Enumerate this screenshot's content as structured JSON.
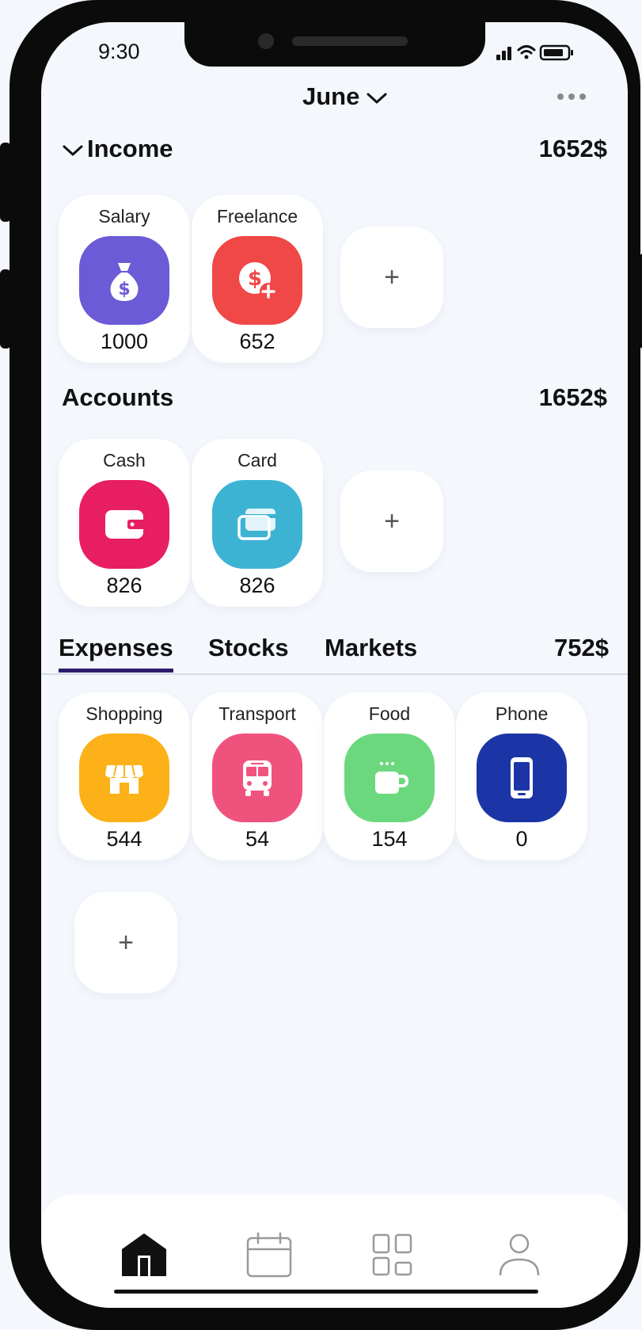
{
  "status_bar": {
    "time": "9:30",
    "icons": [
      "cellular-signal-icon",
      "wifi-icon",
      "battery-icon"
    ]
  },
  "header": {
    "month": "June",
    "menu_icon": "more-horizontal-icon"
  },
  "income": {
    "title": "Income",
    "total": "1652$",
    "items": [
      {
        "label": "Salary",
        "value": "1000",
        "icon": "money-bag-icon",
        "color": "#6B5BD6"
      },
      {
        "label": "Freelance",
        "value": "652",
        "icon": "dollar-plus-icon",
        "color": "#F04747"
      }
    ],
    "add_label": "+"
  },
  "accounts": {
    "title": "Accounts",
    "total": "1652$",
    "items": [
      {
        "label": "Cash",
        "value": "826",
        "icon": "wallet-icon",
        "color": "#E81E63"
      },
      {
        "label": "Card",
        "value": "826",
        "icon": "cards-icon",
        "color": "#3DB3D4"
      }
    ],
    "add_label": "+"
  },
  "tabs": {
    "items": [
      {
        "label": "Expenses",
        "active": true
      },
      {
        "label": "Stocks",
        "active": false
      },
      {
        "label": "Markets",
        "active": false
      }
    ],
    "total": "752$",
    "accent": "#2b1c6e"
  },
  "expenses": {
    "items": [
      {
        "label": "Shopping",
        "value": "544",
        "icon": "store-icon",
        "color": "#FBB117"
      },
      {
        "label": "Transport",
        "value": "54",
        "icon": "bus-icon",
        "color": "#F0527E"
      },
      {
        "label": "Food",
        "value": "154",
        "icon": "coffee-cup-icon",
        "color": "#6CD87E"
      },
      {
        "label": "Phone",
        "value": "0",
        "icon": "smartphone-icon",
        "color": "#1C35A6"
      }
    ],
    "add_label": "+"
  },
  "bottom_nav": {
    "items": [
      {
        "name": "home",
        "icon": "home-icon",
        "active": true
      },
      {
        "name": "calendar",
        "icon": "calendar-icon",
        "active": false
      },
      {
        "name": "dashboard",
        "icon": "dashboard-icon",
        "active": false
      },
      {
        "name": "profile",
        "icon": "user-icon",
        "active": false
      }
    ]
  }
}
